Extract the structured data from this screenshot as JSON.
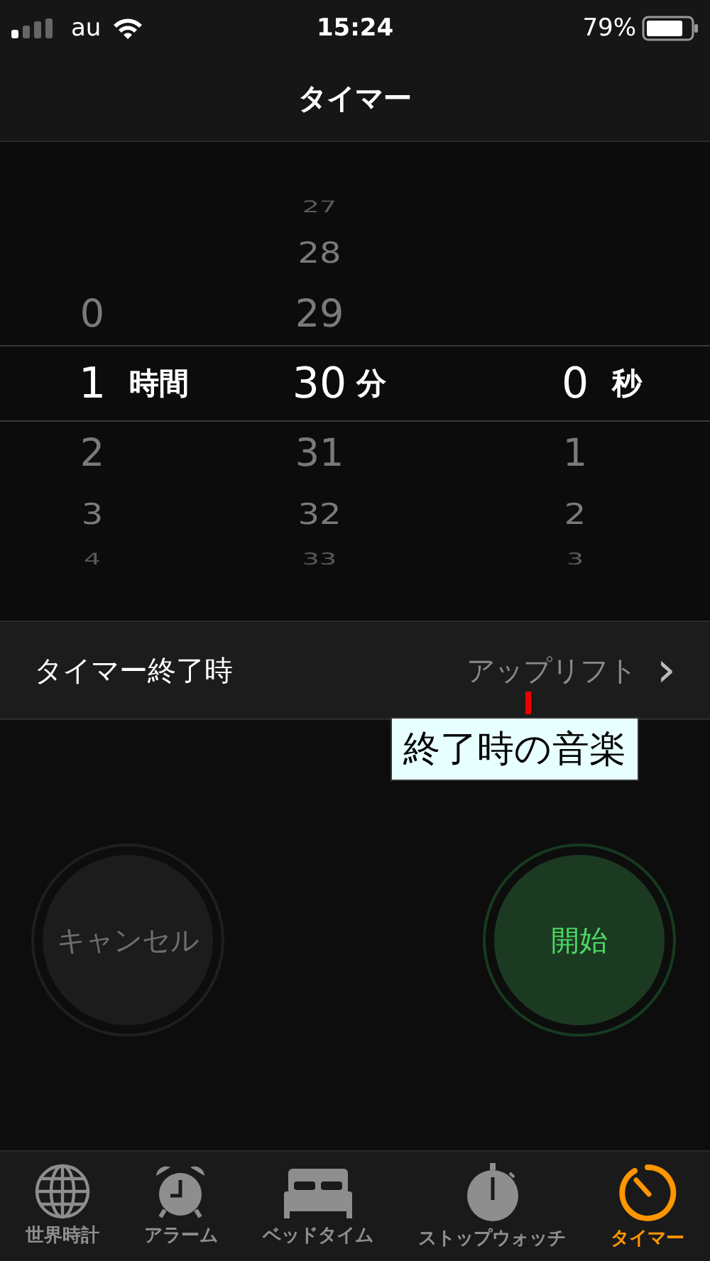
{
  "status_bar": {
    "carrier": "au",
    "time": "15:24",
    "battery": "79%"
  },
  "nav": {
    "title": "タイマー"
  },
  "picker": {
    "columns": [
      {
        "above": [
          "0"
        ],
        "value": "1",
        "unit": "時間",
        "below": [
          "2",
          "3",
          "4"
        ]
      },
      {
        "above": [
          "27",
          "28",
          "29"
        ],
        "value": "30",
        "unit": "分",
        "below": [
          "31",
          "32",
          "33"
        ]
      },
      {
        "value": "0",
        "unit": "秒",
        "below": [
          "1",
          "2",
          "3"
        ]
      }
    ]
  },
  "end_action": {
    "label": "タイマー終了時",
    "value": "アップリフト",
    "chevron": "›"
  },
  "callout": {
    "text": "終了時の音楽"
  },
  "buttons": [
    {
      "kind": "cancel",
      "label": "キャンセル"
    },
    {
      "kind": "start",
      "label": "開始"
    }
  ],
  "tabs": [
    {
      "kind": "globe",
      "label": "世界時計",
      "selected": false
    },
    {
      "kind": "alarm",
      "label": "アラーム",
      "selected": false
    },
    {
      "kind": "bed",
      "label": "ベッドタイム",
      "selected": false
    },
    {
      "kind": "stopwatch",
      "label": "ストップウォッチ",
      "selected": false
    },
    {
      "kind": "timer",
      "label": "タイマー",
      "selected": true
    }
  ]
}
